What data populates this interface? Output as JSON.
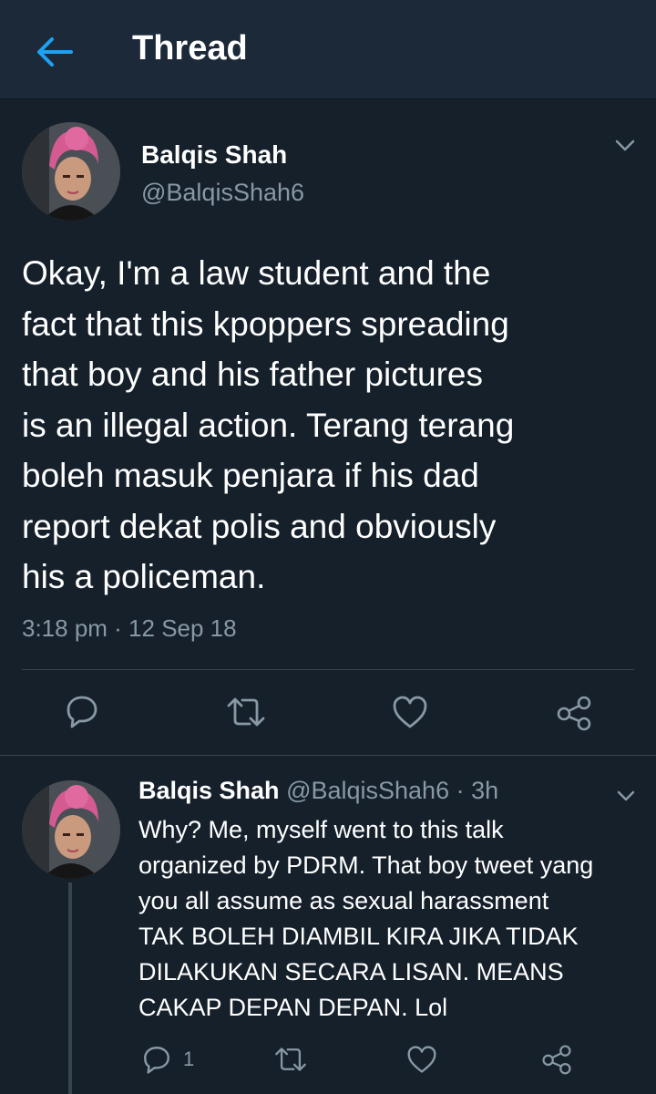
{
  "header": {
    "title": "Thread"
  },
  "tweet": {
    "author_name": "Balqis Shah",
    "author_handle": "@BalqisShah6",
    "text": "Okay, I'm a law student and the\nfact that this kpoppers spreading\nthat boy and his father pictures\nis an illegal action. Terang terang\nboleh masuk penjara if his dad\nreport dekat polis and obviously\nhis a policeman.",
    "timestamp": "3:18 pm · 12 Sep 18"
  },
  "reply": {
    "author_name": "Balqis Shah",
    "author_handle": "@BalqisShah6",
    "separator": "·",
    "age": "3h",
    "text": "Why? Me, myself went to this talk\norganized by PDRM. That boy tweet yang\nyou all assume as sexual harassment\nTAK BOLEH DIAMBIL KIRA JIKA TIDAK\nDILAKUKAN SECARA LISAN. MEANS\nCAKAP DEPAN DEPAN. Lol",
    "reply_count": "1"
  },
  "colors": {
    "background": "#15202b",
    "header": "#1c2938",
    "accent": "#1da1f2",
    "muted": "#8899a6",
    "divider": "#38444d"
  },
  "icons": [
    "back-arrow-icon",
    "chevron-down-icon",
    "reply-icon",
    "retweet-icon",
    "like-icon",
    "share-icon"
  ]
}
